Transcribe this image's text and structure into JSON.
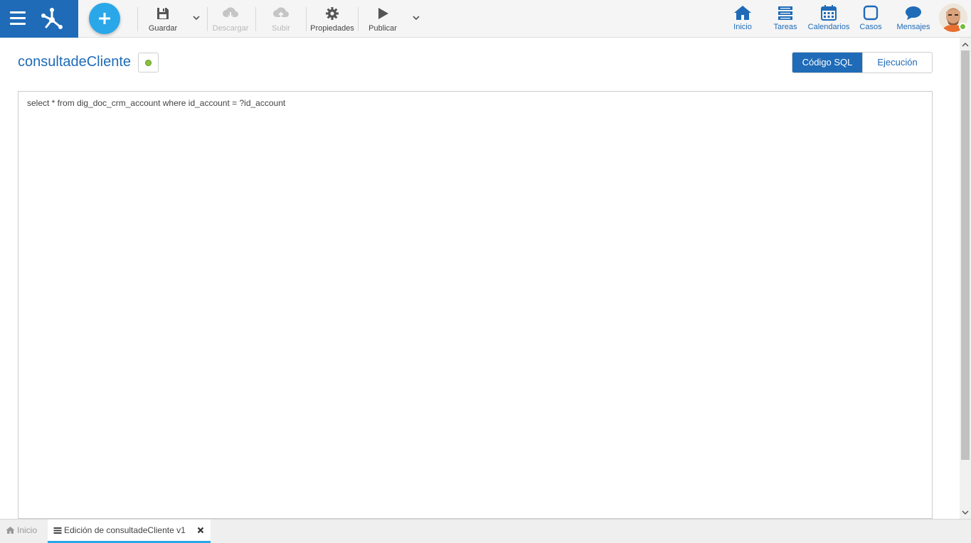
{
  "toolbar": {
    "guardar": "Guardar",
    "descargar": "Descargar",
    "subir": "Subir",
    "propiedades": "Propiedades",
    "publicar": "Publicar"
  },
  "nav": {
    "inicio": "Inicio",
    "tareas": "Tareas",
    "calendarios": "Calendarios",
    "casos": "Casos",
    "mensajes": "Mensajes"
  },
  "page": {
    "title": "consultadeCliente",
    "status_color": "#8cbf3f"
  },
  "view_toggle": {
    "sql": "Código SQL",
    "ejecucion": "Ejecución"
  },
  "editor": {
    "code": "select * from dig_doc_crm_account where id_account = ?id_account"
  },
  "bottom_tabs": {
    "home": "Inicio",
    "active": "Edición de consultadeCliente v1"
  },
  "colors": {
    "brand": "#1f6bb7",
    "accent": "#2aa7e8"
  }
}
